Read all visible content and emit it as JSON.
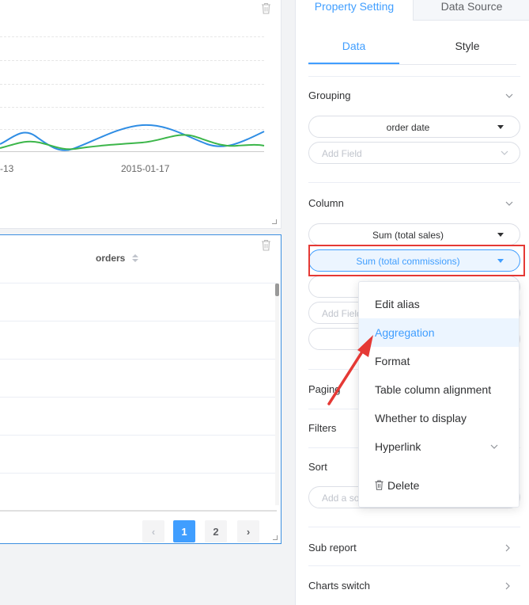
{
  "chart": {
    "x_ticks": [
      "-13",
      "2015-01-17"
    ]
  },
  "table": {
    "header": "orders",
    "pager": {
      "pages": [
        "1",
        "2"
      ],
      "current": "1",
      "prev": "‹",
      "next": "›"
    }
  },
  "panel": {
    "top_tabs": [
      "Property Setting",
      "Data Source"
    ],
    "sub_tabs": [
      "Data",
      "Style"
    ],
    "grouping": {
      "title": "Grouping",
      "field": "order date",
      "add_placeholder": "Add Field"
    },
    "column": {
      "title": "Column",
      "fields": [
        "Sum (total sales)",
        "Sum (total commissions)"
      ],
      "add_placeholder": "Add Field"
    },
    "paging": "Paging",
    "filters": "Filters",
    "sort": {
      "title": "Sort",
      "placeholder": "Add a so"
    },
    "sub_report": "Sub report",
    "charts_switch": "Charts switch"
  },
  "menu": {
    "items": [
      "Edit alias",
      "Aggregation",
      "Format",
      "Table column alignment",
      "Whether to display",
      "Hyperlink"
    ],
    "delete": "Delete"
  },
  "colors": {
    "accent": "#409eff",
    "highlight": "#e53935",
    "line_blue": "#2f8de4",
    "line_green": "#3cb64a"
  }
}
